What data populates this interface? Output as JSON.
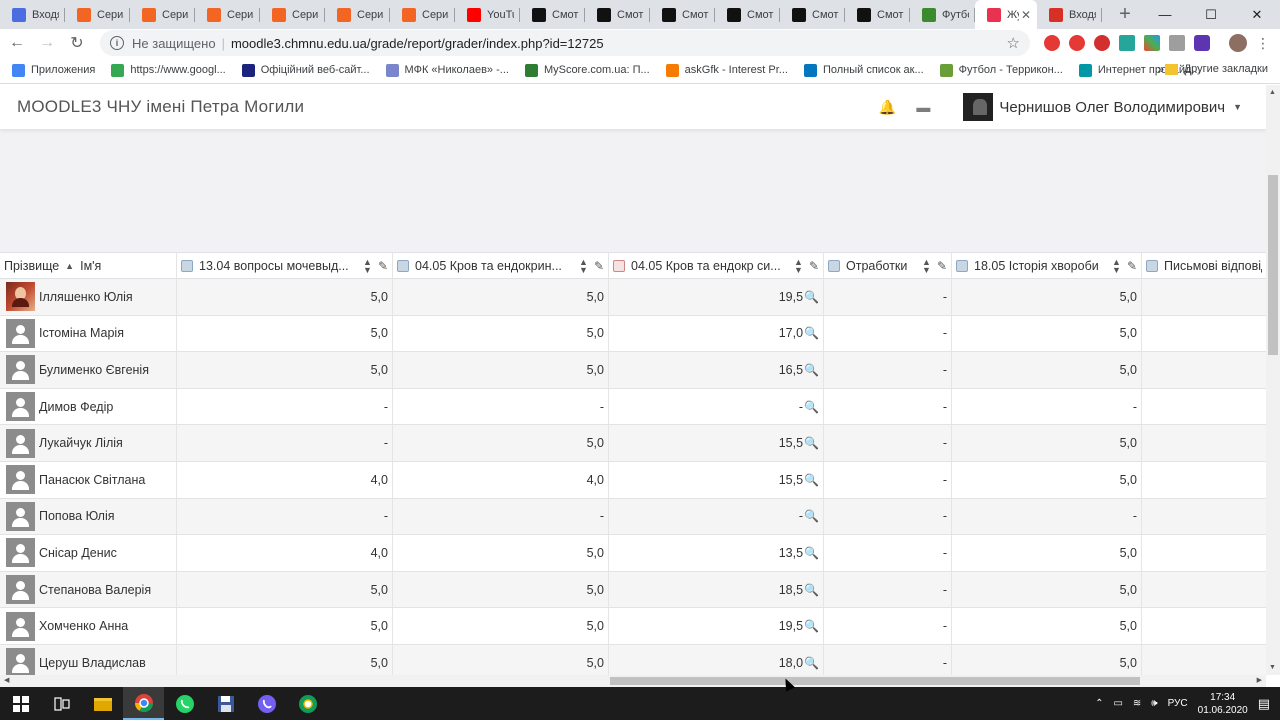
{
  "browser": {
    "tabs": [
      {
        "title": "Входящ",
        "icon": "gmail-icon",
        "color": "#4a6ee0"
      },
      {
        "title": "Сериал",
        "icon": "serial-icon",
        "color": "#f26522"
      },
      {
        "title": "Сериал",
        "icon": "serial-icon",
        "color": "#f26522"
      },
      {
        "title": "Сериал",
        "icon": "serial-icon",
        "color": "#f26522"
      },
      {
        "title": "Сериал",
        "icon": "serial-icon",
        "color": "#f26522"
      },
      {
        "title": "Сериал",
        "icon": "serial-icon",
        "color": "#f26522"
      },
      {
        "title": "Сериал",
        "icon": "serial-icon",
        "color": "#f26522"
      },
      {
        "title": "YouTub",
        "icon": "youtube-icon",
        "color": "#ff0000"
      },
      {
        "title": "Смотр",
        "icon": "hd-icon",
        "color": "#111111"
      },
      {
        "title": "Смотр",
        "icon": "hd-icon",
        "color": "#111111"
      },
      {
        "title": "Смотр",
        "icon": "hd-icon",
        "color": "#111111"
      },
      {
        "title": "Смотр",
        "icon": "hd-icon",
        "color": "#111111"
      },
      {
        "title": "Смотр",
        "icon": "hd-icon",
        "color": "#111111"
      },
      {
        "title": "Смотр",
        "icon": "hd-icon",
        "color": "#111111"
      },
      {
        "title": "Футбо",
        "icon": "football-icon",
        "color": "#3c8a2e"
      },
      {
        "title": "Жу",
        "icon": "moodle-icon",
        "color": "#e8324f",
        "active": true
      },
      {
        "title": "Входя",
        "icon": "gmail-icon",
        "color": "#d93025"
      }
    ],
    "new_tab_label": "+",
    "address": {
      "security_label": "Не защищено",
      "url": "moodle3.chmnu.edu.ua/grade/report/grader/index.php?id=12725"
    },
    "bookmarks": [
      {
        "label": "Приложения",
        "color": "#4285f4"
      },
      {
        "label": "https://www.googl...",
        "color": "#34a853"
      },
      {
        "label": "Офіційний веб-сайт...",
        "color": "#1a237e"
      },
      {
        "label": "МФК «Николаев» -...",
        "color": "#7986cb"
      },
      {
        "label": "MyScore.com.ua: П...",
        "color": "#2e7d32"
      },
      {
        "label": "askGfk - Interest Pr...",
        "color": "#f57c00"
      },
      {
        "label": "Полный список ак...",
        "color": "#0277bd"
      },
      {
        "label": "Футбол - Террикон...",
        "color": "#689f38"
      },
      {
        "label": "Интернет провайд...",
        "color": "#0097a7"
      }
    ],
    "bookmarks_more": "»",
    "other_bookmarks": "Другие закладки"
  },
  "moodle": {
    "site_name": "MOODLE3 ЧНУ імені Петра Могили",
    "user_name": "Чернишов Олег Володимирович"
  },
  "grader": {
    "name_header_last": "Прізвище",
    "name_header_first": "Ім'я",
    "columns": [
      {
        "title": "13.04 вопросы мочевыд...",
        "type": "assign"
      },
      {
        "title": "04.05 Кров та ендокрин...",
        "type": "assign"
      },
      {
        "title": "04.05 Кров та ендокр си...",
        "type": "quiz"
      },
      {
        "title": "Отработки",
        "type": "assign"
      },
      {
        "title": "18.05 Історія хвороби",
        "type": "assign"
      },
      {
        "title": "Письмові відповіді",
        "type": "assign"
      }
    ],
    "rows": [
      {
        "name": "Ілляшенко Юлія",
        "photo": true,
        "grades": [
          "5,0",
          "5,0",
          "19,5",
          "-",
          "5,0",
          ""
        ]
      },
      {
        "name": "Істоміна Марія",
        "photo": false,
        "grades": [
          "5,0",
          "5,0",
          "17,0",
          "-",
          "5,0",
          ""
        ]
      },
      {
        "name": "Булименко Євгенія",
        "photo": false,
        "grades": [
          "5,0",
          "5,0",
          "16,5",
          "-",
          "5,0",
          ""
        ]
      },
      {
        "name": "Димов Федір",
        "photo": false,
        "grades": [
          "-",
          "-",
          "-",
          "-",
          "-",
          ""
        ]
      },
      {
        "name": "Лукайчук Лілія",
        "photo": false,
        "grades": [
          "-",
          "5,0",
          "15,5",
          "-",
          "5,0",
          ""
        ]
      },
      {
        "name": "Панасюк Світлана",
        "photo": false,
        "grades": [
          "4,0",
          "4,0",
          "15,5",
          "-",
          "5,0",
          ""
        ]
      },
      {
        "name": "Попова Юлія",
        "photo": false,
        "grades": [
          "-",
          "-",
          "-",
          "-",
          "-",
          ""
        ]
      },
      {
        "name": "Снісар Денис",
        "photo": false,
        "grades": [
          "4,0",
          "5,0",
          "13,5",
          "-",
          "5,0",
          ""
        ]
      },
      {
        "name": "Степанова Валерія",
        "photo": false,
        "grades": [
          "5,0",
          "5,0",
          "18,5",
          "-",
          "5,0",
          ""
        ]
      },
      {
        "name": "Хомченко Анна",
        "photo": false,
        "grades": [
          "5,0",
          "5,0",
          "19,5",
          "-",
          "5,0",
          ""
        ]
      },
      {
        "name": "Церуш Владислав",
        "photo": false,
        "grades": [
          "5,0",
          "5,0",
          "18,0",
          "-",
          "5,0",
          ""
        ]
      }
    ]
  },
  "taskbar": {
    "apps": [
      "windows-start-icon",
      "task-view-icon",
      "file-explorer-icon",
      "chrome-icon",
      "whatsapp-icon",
      "save-icon",
      "viber-icon",
      "chrome-alt-icon"
    ],
    "language": "РУС",
    "time": "17:34",
    "date": "01.06.2020"
  }
}
